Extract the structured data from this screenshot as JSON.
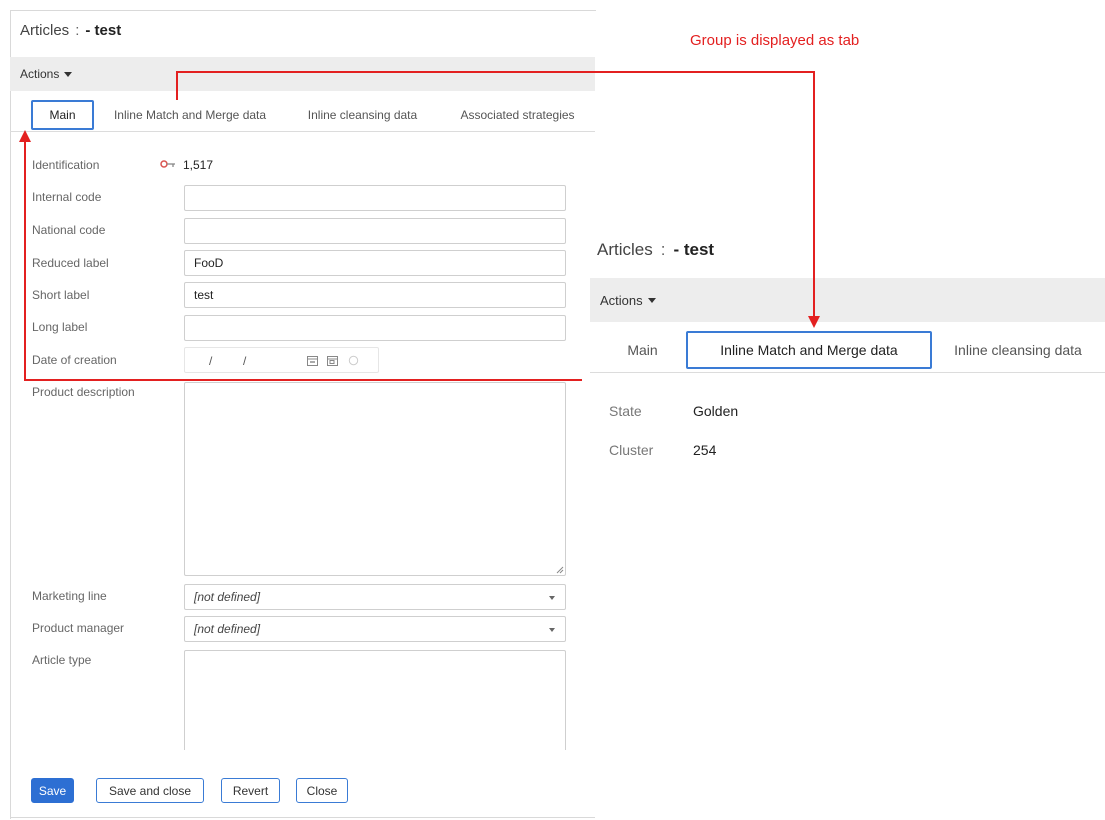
{
  "annotation": "Group is displayed as tab",
  "left": {
    "title": {
      "entity": "Articles",
      "separator": ":",
      "name": "- test"
    },
    "actions_label": "Actions",
    "tabs": [
      "Main",
      "Inline Match and Merge data",
      "Inline cleansing data",
      "Associated strategies"
    ],
    "fields": {
      "identification": {
        "label": "Identification",
        "value": "1,517"
      },
      "internal_code": {
        "label": "Internal code",
        "value": ""
      },
      "national_code": {
        "label": "National code",
        "value": ""
      },
      "reduced_label": {
        "label": "Reduced label",
        "value": "FooD"
      },
      "short_label": {
        "label": "Short label",
        "value": "test"
      },
      "long_label": {
        "label": "Long label",
        "value": ""
      },
      "date_of_creation": {
        "label": "Date of creation",
        "sep1": "/",
        "sep2": "/"
      },
      "product_description": {
        "label": "Product description",
        "value": ""
      },
      "marketing_line": {
        "label": "Marketing line",
        "value": "[not defined]"
      },
      "product_manager": {
        "label": "Product manager",
        "value": "[not defined]"
      },
      "article_type": {
        "label": "Article type",
        "value": ""
      }
    },
    "buttons": {
      "save": "Save",
      "save_close": "Save and close",
      "revert": "Revert",
      "close": "Close"
    }
  },
  "right": {
    "title": {
      "entity": "Articles",
      "separator": ":",
      "name": "- test"
    },
    "actions_label": "Actions",
    "tabs": [
      "Main",
      "Inline Match and Merge data",
      "Inline cleansing data"
    ],
    "fields": {
      "state": {
        "label": "State",
        "value": "Golden"
      },
      "cluster": {
        "label": "Cluster",
        "value": "254"
      }
    }
  },
  "colors": {
    "annotation": "#e32020",
    "accent": "#3a7bd5",
    "primary_button": "#2d6fd3"
  }
}
